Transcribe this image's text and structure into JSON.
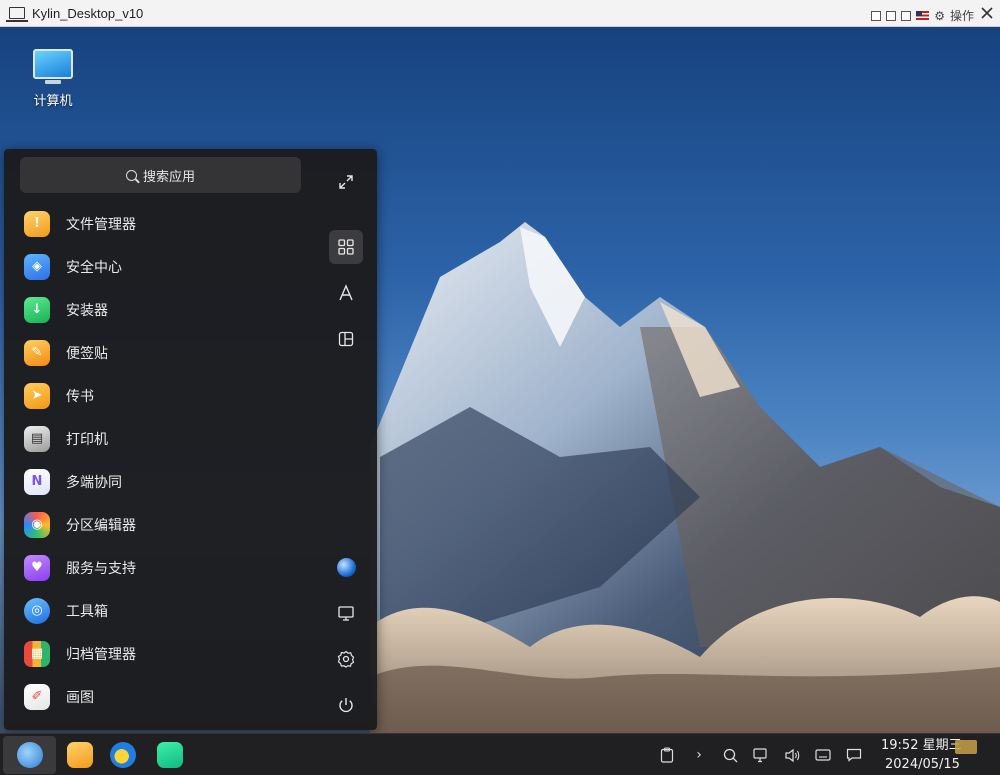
{
  "window": {
    "title": "Kylin_Desktop_v10",
    "ops_label": "操作"
  },
  "desktop": {
    "icons": [
      {
        "label": "计算机",
        "icon": "computer-icon"
      }
    ]
  },
  "start_menu": {
    "search_placeholder": "搜索应用",
    "apps": [
      {
        "label": "文件管理器",
        "icon": "file-manager-icon",
        "color": "#f5a623"
      },
      {
        "label": "安全中心",
        "icon": "security-center-icon",
        "color": "#3a8ef0"
      },
      {
        "label": "安装器",
        "icon": "installer-icon",
        "color": "#2ecf6b"
      },
      {
        "label": "便签贴",
        "icon": "sticky-notes-icon",
        "color": "#f7a21b"
      },
      {
        "label": "传书",
        "icon": "messenger-icon",
        "color": "#f5a623"
      },
      {
        "label": "打印机",
        "icon": "printer-icon",
        "color": "#d9d9d9"
      },
      {
        "label": "多端协同",
        "icon": "multi-device-icon",
        "color": "#8e6cf7"
      },
      {
        "label": "分区编辑器",
        "icon": "partition-editor-icon",
        "color": "#ff6b4a"
      },
      {
        "label": "服务与支持",
        "icon": "service-support-icon",
        "color": "#a259f7"
      },
      {
        "label": "工具箱",
        "icon": "toolbox-icon",
        "color": "#2f8cff"
      },
      {
        "label": "归档管理器",
        "icon": "archive-manager-icon",
        "color": "#e84b3c"
      },
      {
        "label": "画图",
        "icon": "paint-icon",
        "color": "#f5f5f5"
      }
    ],
    "side_buttons": [
      {
        "name": "expand-icon",
        "glyph": "⤢"
      },
      {
        "name": "all-apps-icon",
        "glyph": "▦"
      },
      {
        "name": "letter-sort-icon",
        "glyph": "A"
      },
      {
        "name": "category-icon",
        "glyph": "◫"
      },
      {
        "name": "user-avatar-icon",
        "glyph": "●"
      },
      {
        "name": "computer-icon",
        "glyph": "▭"
      },
      {
        "name": "settings-icon",
        "glyph": "⚙"
      },
      {
        "name": "power-icon",
        "glyph": "⏻"
      }
    ]
  },
  "taskbar": {
    "time": "19:52 星期三",
    "date": "2024/05/15"
  },
  "colors": {
    "menu_bg": "#1c1c1e",
    "taskbar_bg": "#202022"
  }
}
